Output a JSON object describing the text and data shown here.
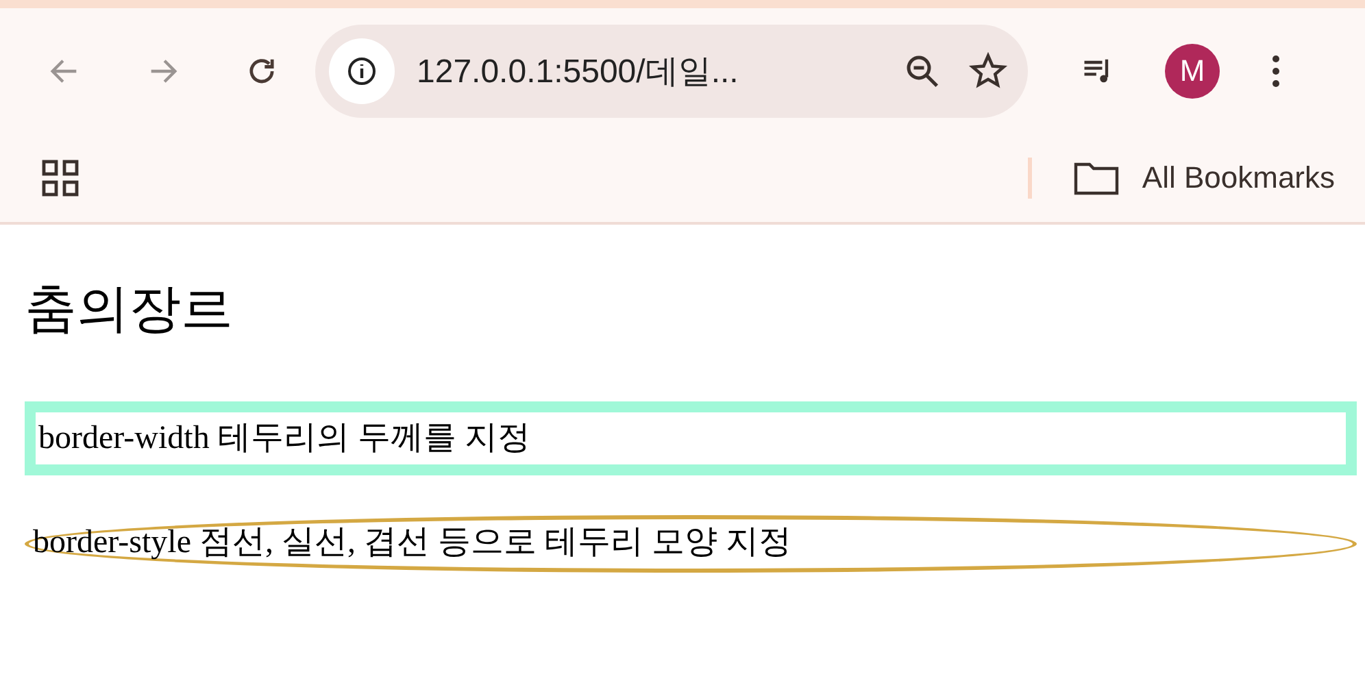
{
  "browser": {
    "address": "127.0.0.1:5500/데일...",
    "profile_initial": "M",
    "bookmarks_label": "All Bookmarks"
  },
  "page": {
    "heading": "춤의장르",
    "boxes": [
      {
        "kind": "thick",
        "color": "#a0f8d8",
        "text": "border-width 테두리의 두께를 지정"
      },
      {
        "kind": "ellipse",
        "color": "#d4a843",
        "text": "border-style 점선, 실선, 겹선 등으로 테두리 모양 지정"
      }
    ]
  }
}
